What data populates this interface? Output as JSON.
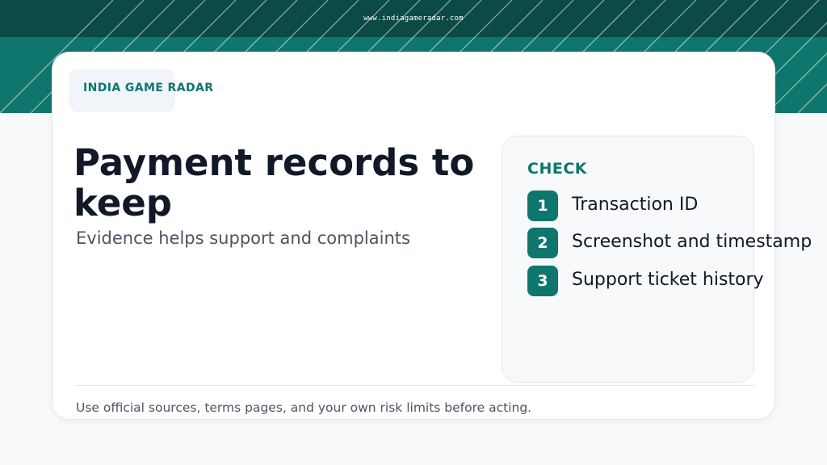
{
  "header": {
    "site_url": "www.indiagameradar.com"
  },
  "brand": {
    "name": "INDIA GAME RADAR"
  },
  "main": {
    "title": "Payment records to keep",
    "subtitle": "Evidence helps support and complaints"
  },
  "check": {
    "label": "CHECK",
    "items": [
      {
        "number": "1",
        "text": "Transaction ID"
      },
      {
        "number": "2",
        "text": "Screenshot and timestamp"
      },
      {
        "number": "3",
        "text": "Support ticket history"
      }
    ]
  },
  "footer": {
    "note": "Use official sources, terms pages, and your own risk limits before acting."
  },
  "colors": {
    "accent": "#0f766e",
    "accent_dark": "#0b4a45",
    "text_dark": "#111827",
    "text_muted": "#4b5563"
  }
}
